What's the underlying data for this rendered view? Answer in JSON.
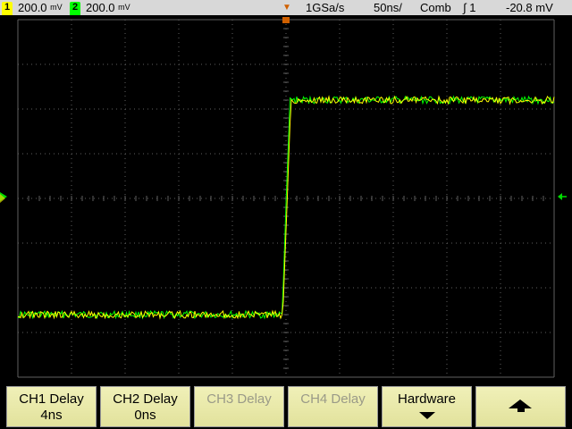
{
  "status_bar": {
    "ch1_badge": "1",
    "ch1_scale": "200.0",
    "ch1_unit": "mV",
    "ch2_badge": "2",
    "ch2_scale": "200.0",
    "ch2_unit": "mV",
    "sample_rate": "1GSa/s",
    "timebase": "50ns/",
    "acq_mode": "Comb",
    "trigger_source": "1",
    "trigger_level": "-20.8 mV"
  },
  "colors": {
    "ch1": "#ffff00",
    "ch2": "#00ff00",
    "trigger_marker": "#ff8000",
    "softkey": "#ececb0"
  },
  "waveform": {
    "low_level_divs": 2.6,
    "high_level_divs": 2.2,
    "edge_time_divs": 0.0,
    "rise_time_ns": 4
  },
  "softkeys": [
    {
      "line1": "CH1 Delay",
      "line2": "4ns",
      "enabled": true
    },
    {
      "line1": "CH2 Delay",
      "line2": "0ns",
      "enabled": true
    },
    {
      "line1": "CH3 Delay",
      "line2": "",
      "enabled": false
    },
    {
      "line1": "CH4 Delay",
      "line2": "",
      "enabled": false
    },
    {
      "line1": "Hardware",
      "line2": "",
      "enabled": true,
      "icon": "arrow-down-icon"
    },
    {
      "line1": "",
      "line2": "",
      "enabled": true,
      "icon": "arrow-up-icon"
    }
  ]
}
